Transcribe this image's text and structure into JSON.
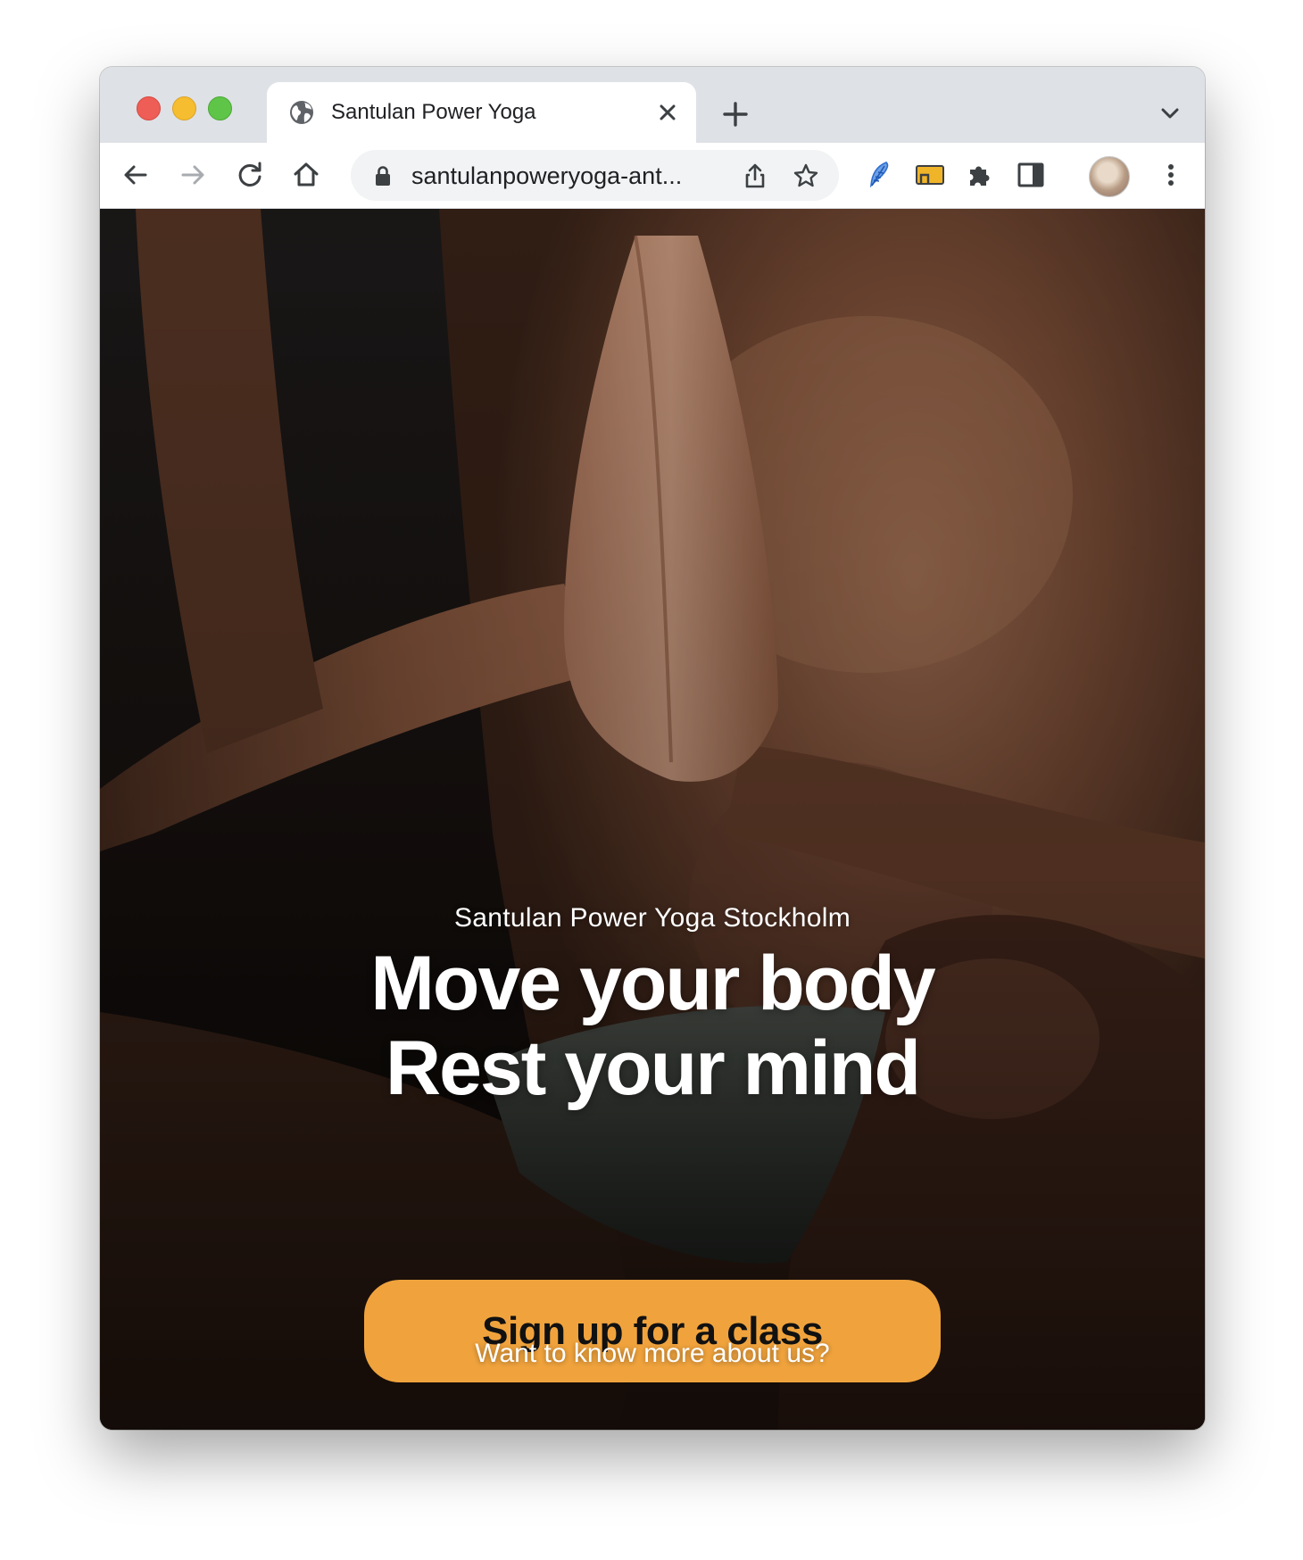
{
  "browser": {
    "tab": {
      "title": "Santulan Power Yoga"
    },
    "address_bar": {
      "url": "santulanpoweryoga-ant..."
    }
  },
  "hero": {
    "kicker": "Santulan Power Yoga Stockholm",
    "headline_line1": "Move your body",
    "headline_line2": "Rest your mind",
    "cta_label": "Sign up for a class",
    "more_link": "Want to know more about us?"
  },
  "colors": {
    "cta_background": "#f0a33d",
    "tab_strip": "#dee1e6",
    "traffic_red": "#ee5e56",
    "traffic_yellow": "#f5bd2f",
    "traffic_green": "#5fc548"
  },
  "icons": [
    "globe-icon",
    "close-icon",
    "plus-icon",
    "chevron-down-icon",
    "back-arrow-icon",
    "forward-arrow-icon",
    "reload-icon",
    "home-icon",
    "lock-icon",
    "share-icon",
    "star-icon",
    "feather-extension-icon",
    "tab-cast-icon",
    "puzzle-icon",
    "side-panel-icon",
    "kebab-menu-icon"
  ]
}
